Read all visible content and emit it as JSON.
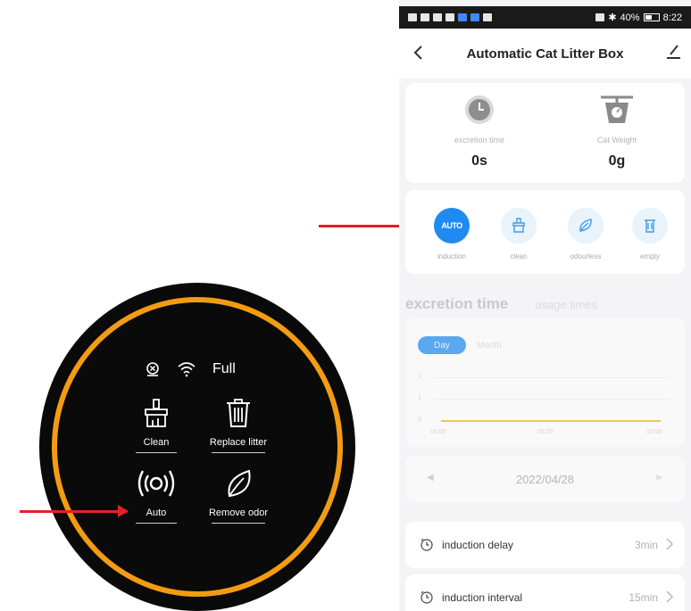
{
  "device_panel": {
    "status_full": "Full",
    "buttons": {
      "clean": "Clean",
      "replace_litter": "Replace litter",
      "auto": "Auto",
      "remove_odor": "Remove odor"
    },
    "icons": [
      "sensor-alert-icon",
      "wifi-icon",
      "brush-icon",
      "trash-icon",
      "auto-signal-icon",
      "leaf-icon"
    ],
    "colors": {
      "panel": "#0a0a0a",
      "ring": "#f39c12"
    }
  },
  "arrows": {
    "color": "#e3202a"
  },
  "phone": {
    "status_bar": {
      "battery": "40%",
      "time": "8:22"
    },
    "header": {
      "title": "Automatic Cat Litter Box"
    },
    "stats": [
      {
        "caption": "excretion time",
        "value": "0s",
        "icon": "clock-icon"
      },
      {
        "caption": "Cat Weight",
        "value": "0g",
        "icon": "scale-icon"
      }
    ],
    "modes": [
      {
        "label": "induction",
        "icon_text": "AUTO",
        "active": true
      },
      {
        "label": "clean",
        "icon": "clean-icon",
        "active": false
      },
      {
        "label": "odourless",
        "icon": "leaf-icon",
        "active": false
      },
      {
        "label": "empty",
        "icon": "bin-icon",
        "active": false
      }
    ],
    "chart_tabs": {
      "active": "excretion time",
      "inactive": "usage times"
    },
    "chart_segment": {
      "day": "Day",
      "month": "Month"
    },
    "chart_data": {
      "type": "line",
      "x": [
        "00:00",
        "05:20",
        "10:50"
      ],
      "y_ticks": [
        "2",
        "1",
        "0"
      ],
      "series": [
        {
          "values": [
            0,
            0,
            0
          ]
        }
      ],
      "color": "#f3c84a"
    },
    "date_nav": {
      "date": "2022/04/28",
      "prev": "◀",
      "next": "▶"
    },
    "settings": [
      {
        "label": "induction delay",
        "value": "3min"
      },
      {
        "label": "induction interval",
        "value": "15min"
      }
    ],
    "colors": {
      "accent": "#1f8bf0",
      "background": "#f4f4f6"
    }
  }
}
